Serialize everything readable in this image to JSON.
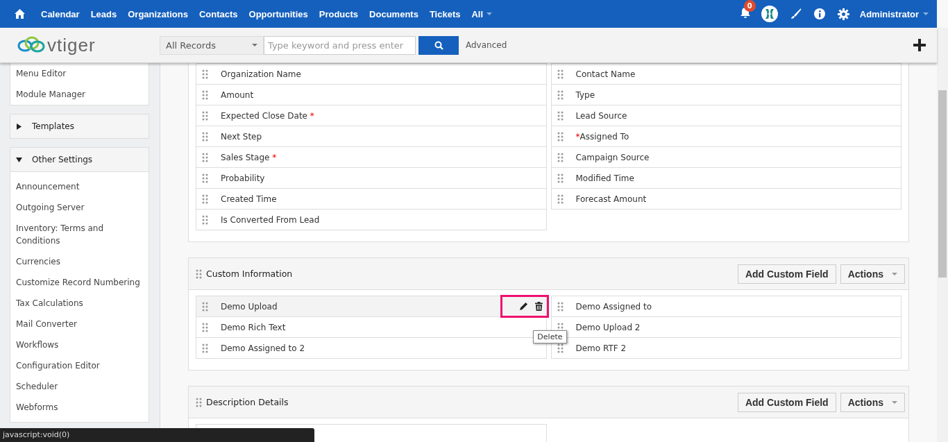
{
  "nav": {
    "items": [
      {
        "label": "Calendar",
        "caret": false
      },
      {
        "label": "Leads",
        "caret": false
      },
      {
        "label": "Organizations",
        "caret": false
      },
      {
        "label": "Contacts",
        "caret": false
      },
      {
        "label": "Opportunities",
        "caret": false
      },
      {
        "label": "Products",
        "caret": false
      },
      {
        "label": "Documents",
        "caret": false
      },
      {
        "label": "Tickets",
        "caret": false
      },
      {
        "label": "All",
        "caret": true
      }
    ],
    "notifications": "0",
    "user": "Administrator"
  },
  "search": {
    "brand": "vtiger",
    "scope": "All Records",
    "placeholder": "Type keyword and press enter",
    "advanced": "Advanced"
  },
  "sidebar": {
    "items": [
      "Menu Editor",
      "Module Manager"
    ],
    "sections": [
      {
        "title": "Templates",
        "expanded": false
      },
      {
        "title": "Other Settings",
        "expanded": true,
        "items": [
          "Announcement",
          "Outgoing Server",
          "Inventory: Terms and Conditions",
          "Currencies",
          "Customize Record Numbering",
          "Tax Calculations",
          "Mail Converter",
          "Workflows",
          "Configuration Editor",
          "Scheduler",
          "Webforms"
        ]
      }
    ]
  },
  "blocks": [
    {
      "left": [
        {
          "label": "Organization Name"
        },
        {
          "label": "Amount"
        },
        {
          "label": "Expected Close Date",
          "mark": "*",
          "mark_before": false
        },
        {
          "label": "Next Step"
        },
        {
          "label": "Sales Stage",
          "mark": "*",
          "mark_before": false
        },
        {
          "label": "Probability"
        },
        {
          "label": "Created Time"
        },
        {
          "label": "Is Converted From Lead"
        }
      ],
      "right": [
        {
          "label": "Contact Name"
        },
        {
          "label": "Type"
        },
        {
          "label": "Lead Source"
        },
        {
          "label": "Assigned To",
          "mark": "*",
          "mark_before": true
        },
        {
          "label": "Campaign Source"
        },
        {
          "label": "Modified Time"
        },
        {
          "label": "Forecast Amount"
        }
      ]
    },
    {
      "title": "Custom Information",
      "add_button": "Add Custom Field",
      "actions_button": "Actions",
      "left": [
        {
          "label": "Demo Upload",
          "hovered": true,
          "tooltip": "Delete"
        },
        {
          "label": "Demo Rich Text"
        },
        {
          "label": "Demo Assigned to 2"
        }
      ],
      "right": [
        {
          "label": "Demo Assigned to"
        },
        {
          "label": "Demo Upload 2"
        },
        {
          "label": "Demo RTF 2"
        }
      ]
    },
    {
      "title": "Description Details",
      "add_button": "Add Custom Field",
      "actions_button": "Actions",
      "left": [
        {
          "hovered": false
        }
      ]
    }
  ],
  "status_bar": "javascript:void(0)"
}
